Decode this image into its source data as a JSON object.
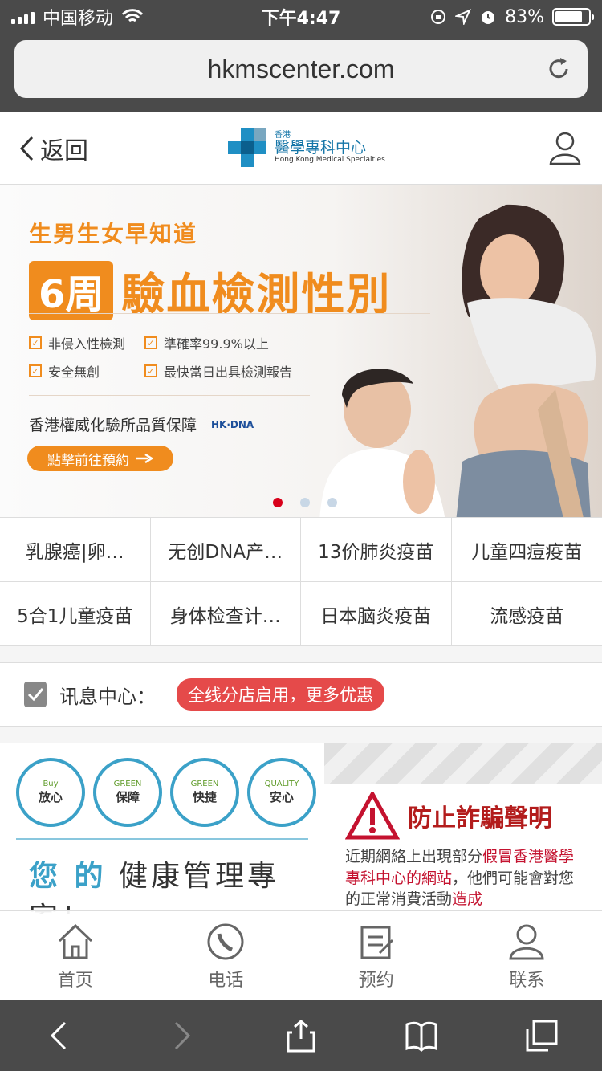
{
  "status_bar": {
    "carrier": "中国移动",
    "time": "下午4:47",
    "battery": "83%",
    "battery_fraction": 0.83
  },
  "url_bar": {
    "domain": "hkmscenter.com"
  },
  "header": {
    "back_label": "返回",
    "logo_small": "香港",
    "logo_main": "醫學專科中心",
    "logo_en": "Hong Kong Medical Specialties"
  },
  "banner": {
    "subtitle": "生男生女早知道",
    "week": "6周",
    "headline": "驗血檢測性別",
    "features": [
      "非侵入性檢測",
      "準確率99.9%以上",
      "安全無創",
      "最快當日出具檢測報告"
    ],
    "quality": "香港權威化驗所品質保障",
    "partner_logo": "HK·DNA",
    "cta": "點擊前往預約",
    "slides": 3,
    "active_slide": 1
  },
  "categories": [
    "乳腺癌|卵…",
    "无创DNA产…",
    "13价肺炎疫苗",
    "儿童四痘疫苗",
    "5合1儿童疫苗",
    "身体检查计…",
    "日本脑炎疫苗",
    "流感疫苗"
  ],
  "news": {
    "label": "讯息中心：",
    "message": "全线分店启用，更多优惠"
  },
  "promo": {
    "badges": [
      {
        "en": "Buy",
        "cn": "放心"
      },
      {
        "en": "GREEN",
        "cn": "保障"
      },
      {
        "en": "GREEN",
        "cn": "快捷"
      },
      {
        "en": "QUALITY",
        "cn": "安心"
      }
    ],
    "slogan_accent": "您 的",
    "slogan": "健康管理專家！",
    "warning_title": "防止詐騙聲明",
    "warning_text_1": "近期網絡上出現部分",
    "warning_red_1": "假冒香港醫學專科中心的網站",
    "warning_text_2": "，他們可能會對您的正常消費活動",
    "warning_red_2": "造成"
  },
  "tabbar": {
    "tabs": [
      "首页",
      "电话",
      "预约",
      "联系"
    ]
  },
  "colors": {
    "brand_orange": "#f08c1e",
    "brand_blue": "#3ba1c8",
    "alert_red": "#e54a4a"
  }
}
